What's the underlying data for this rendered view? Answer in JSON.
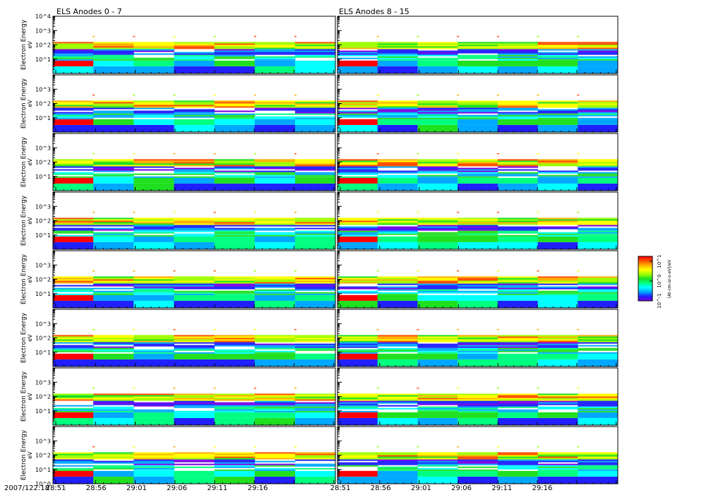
{
  "chart_data": {
    "type": "heatmap",
    "panels_titles": [
      "ELS Anodes 0 - 7",
      "ELS Anodes 8 - 15"
    ],
    "ylabel": "Electron Energy",
    "yunit": "eV",
    "ylim_log10": [
      0,
      4
    ],
    "ytick_labels": [
      "10^0",
      "10^1",
      "10^2",
      "10^3",
      "10^4"
    ],
    "x_date_label": "2007/122:18",
    "xtick_labels": [
      "28:51",
      "28:56",
      "29:01",
      "29:06",
      "29:11",
      "29:16"
    ],
    "rows_per_column": 8,
    "time_bins": 7,
    "colorbar": {
      "label": "(At-cm-sr-s-eV)/eV",
      "tick_labels": [
        "10^1",
        "10^0",
        "10^-1"
      ],
      "colormap": [
        "#7a00e6",
        "#2020ff",
        "#00a8ff",
        "#00ffff",
        "#00ff80",
        "#20e020",
        "#a0ff00",
        "#ffff00",
        "#ffb000",
        "#ff5000",
        "#ff0000"
      ]
    },
    "pattern_seed": 20071
  }
}
